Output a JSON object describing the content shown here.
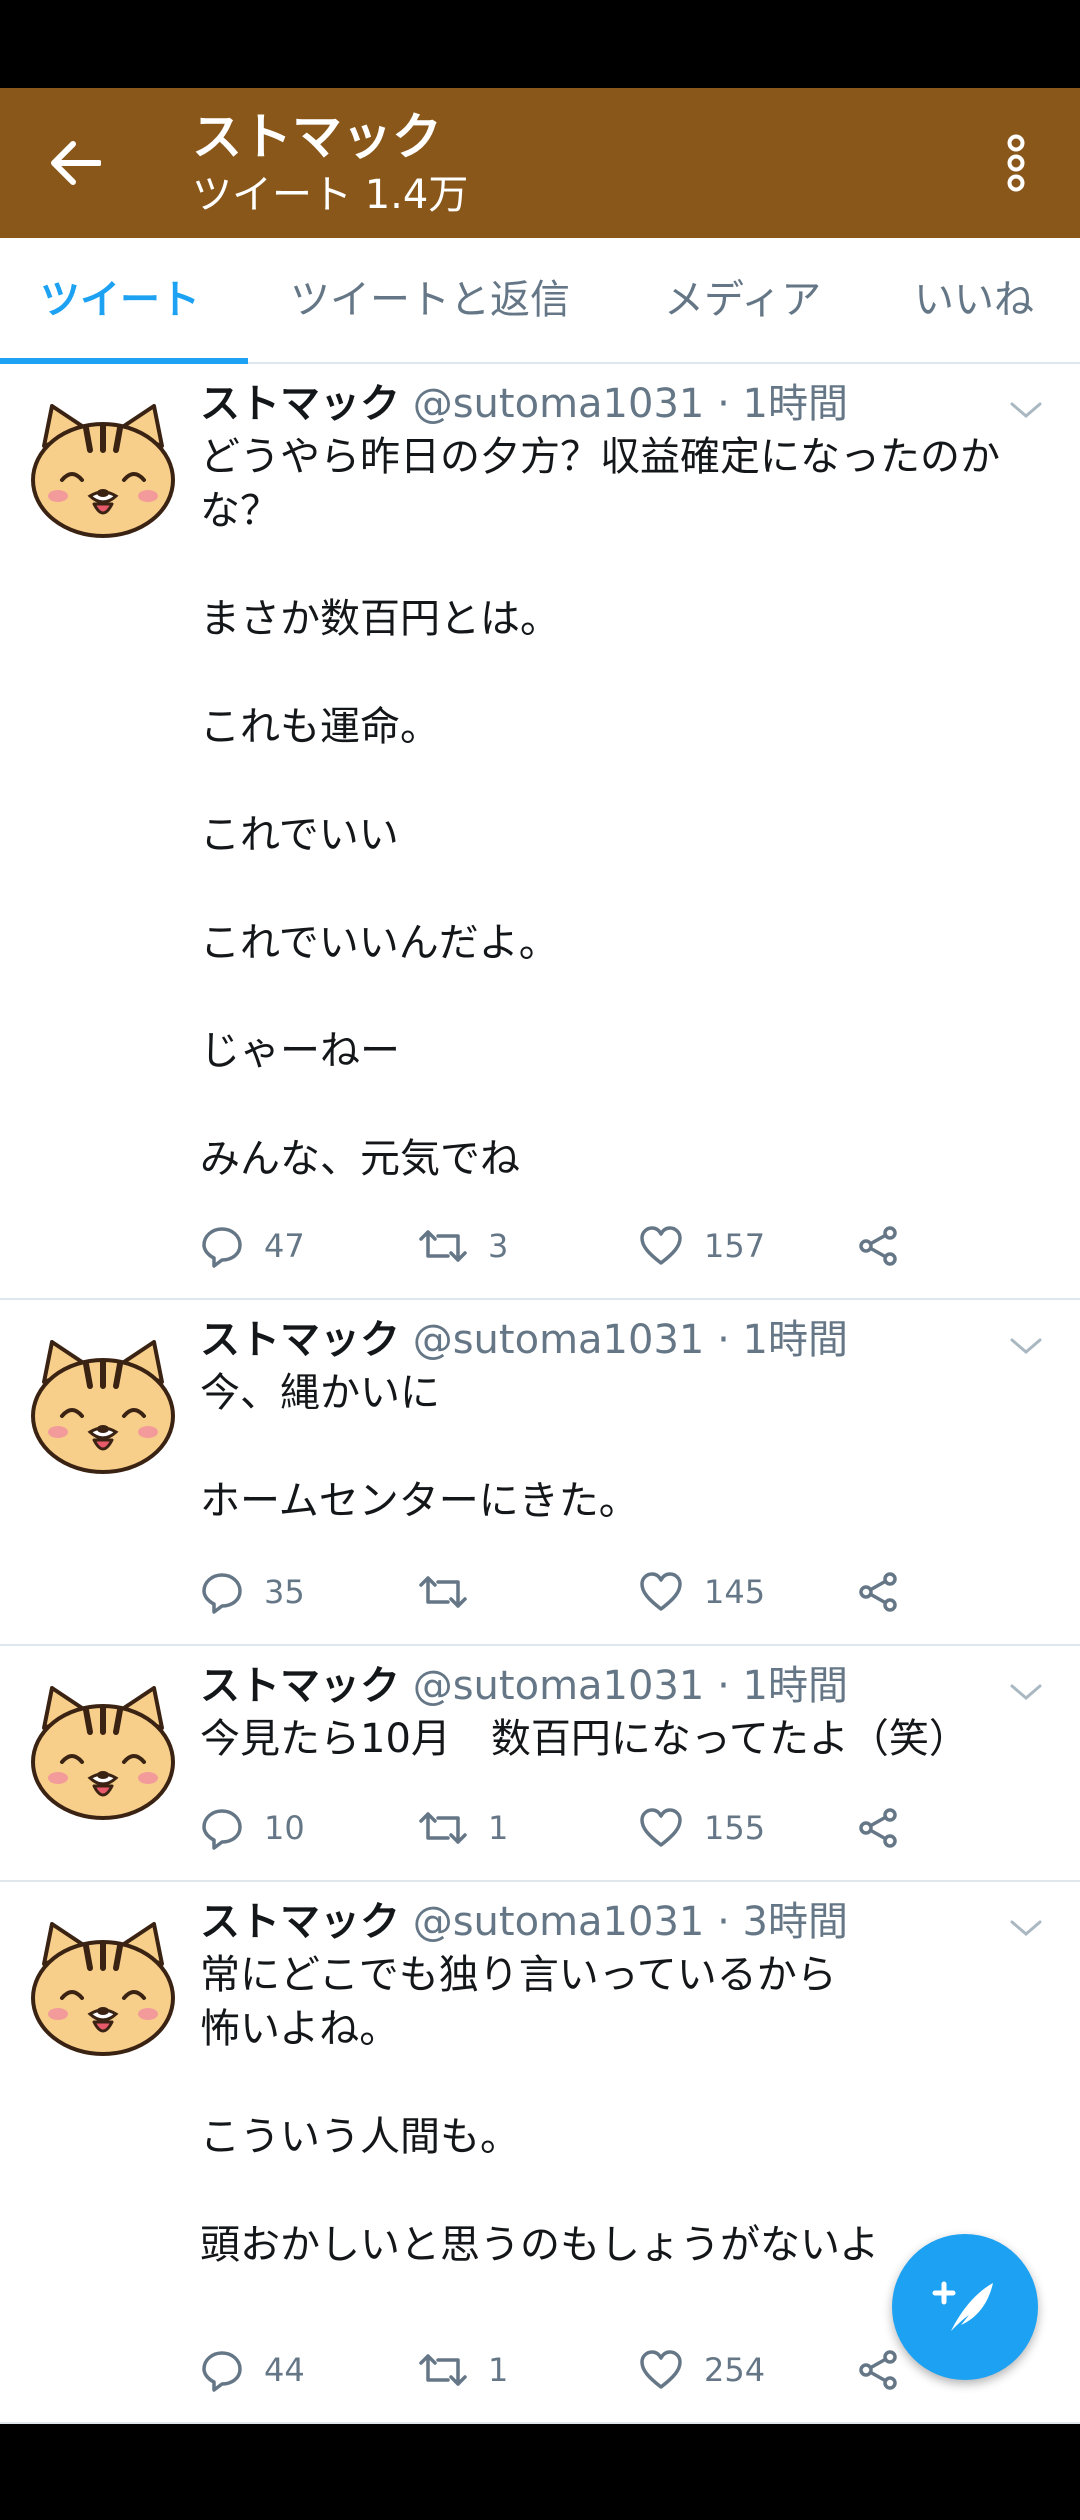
{
  "app_bar": {
    "title": "ストマック",
    "subtitle": "ツイート 1.4万",
    "color": "#8a571a"
  },
  "tabs": [
    {
      "label": "ツイート",
      "active": true
    },
    {
      "label": "ツイートと返信",
      "active": false
    },
    {
      "label": "メディア",
      "active": false
    },
    {
      "label": "いいね",
      "active": false
    }
  ],
  "accent_color": "#1da1f2",
  "tweets": [
    {
      "name": "ストマック",
      "handle": "@sutoma1031",
      "time": "1時間",
      "text": "どうやら昨日の夕方？収益確定になったのかな？\n\nまさか数百円とは。\n\nこれも運命。\n\nこれでいい\n\nこれでいいんだよ。\n\nじゃーねー\n\nみんな、元気でね",
      "replies": "47",
      "retweets": "3",
      "likes": "157"
    },
    {
      "name": "ストマック",
      "handle": "@sutoma1031",
      "time": "1時間",
      "text": "今、縄かいに\n\nホームセンターにきた。",
      "replies": "35",
      "retweets": "",
      "likes": "145"
    },
    {
      "name": "ストマック",
      "handle": "@sutoma1031",
      "time": "1時間",
      "text": "今見たら10月　数百円になってたよ（笑）",
      "replies": "10",
      "retweets": "1",
      "likes": "155"
    },
    {
      "name": "ストマック",
      "handle": "@sutoma1031",
      "time": "3時間",
      "text": "常にどこでも独り言いっているから\n怖いよね。\n\nこういう人間も。\n\n頭おかしいと思うのもしょうがないよ",
      "replies": "44",
      "retweets": "1",
      "likes": "254"
    }
  ],
  "icons": {
    "back": "arrow-left-icon",
    "more": "more-vertical-icon",
    "reply": "reply-icon",
    "retweet": "retweet-icon",
    "like": "heart-icon",
    "share": "share-icon",
    "compose": "compose-tweet-icon"
  }
}
